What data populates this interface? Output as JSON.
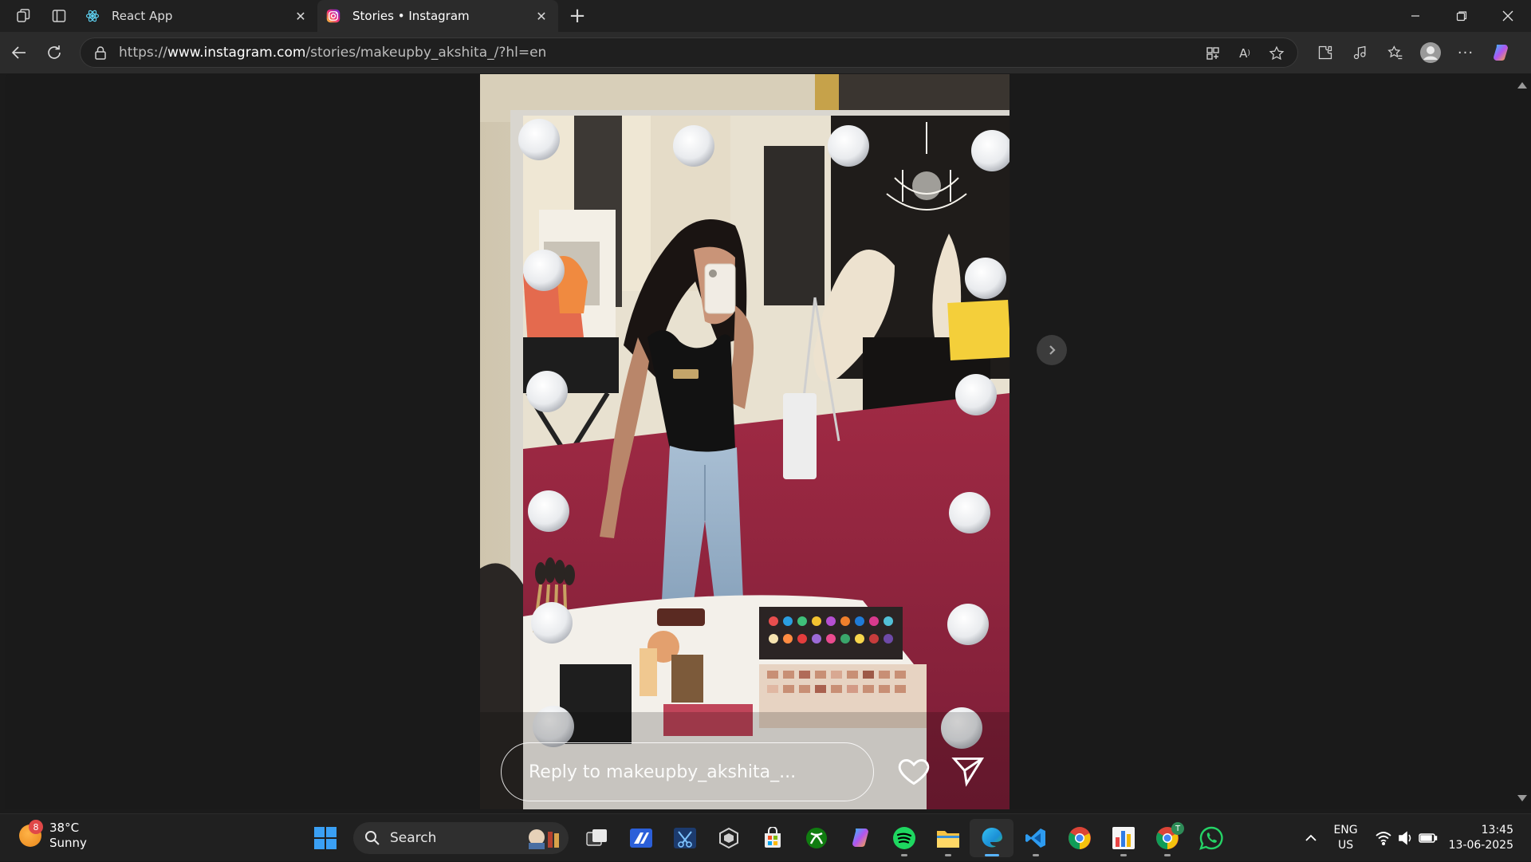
{
  "browser": {
    "tabs": [
      {
        "title": "React App",
        "active": false,
        "icon": "react-icon"
      },
      {
        "title": "Stories • Instagram",
        "active": true,
        "icon": "instagram-icon"
      }
    ],
    "url": {
      "scheme": "https://",
      "domain": "www.instagram.com",
      "path": "/stories/makeupby_akshita_/?hl=en"
    }
  },
  "story": {
    "reply_placeholder": "Reply to makeupby_akshita_...",
    "image_description": "mirror-selfie-in-makeup-room"
  },
  "taskbar": {
    "weather": {
      "temp": "38°C",
      "condition": "Sunny",
      "badge": "8"
    },
    "search_label": "Search",
    "language": {
      "line1": "ENG",
      "line2": "US"
    },
    "clock": {
      "time": "13:45",
      "date": "13-06-2025"
    },
    "chrome_badge": "T"
  },
  "colors": {
    "instagram_gradient": [
      "#f9ce34",
      "#ee2a7b",
      "#6228d7"
    ],
    "edge_accent": "#58b4ff",
    "page_bg": "#1a1a1a"
  }
}
